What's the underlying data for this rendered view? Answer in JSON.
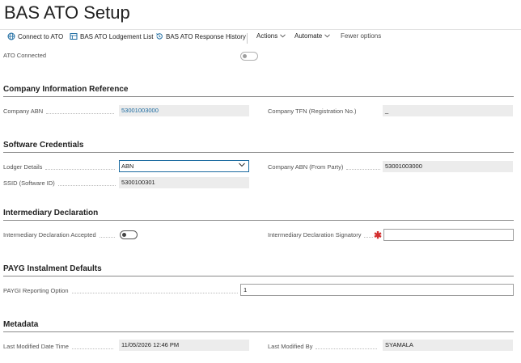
{
  "page": {
    "title": "BAS ATO Setup"
  },
  "toolbar": {
    "connect": "Connect to ATO",
    "lodgement_list": "BAS ATO Lodgement List",
    "response_history": "BAS ATO Response History",
    "actions": "Actions",
    "automate": "Automate",
    "fewer_options": "Fewer options"
  },
  "general": {
    "ato_connected_label": "ATO Connected",
    "ato_connected": false
  },
  "company_info": {
    "heading": "Company Information Reference",
    "abn_label": "Company ABN",
    "abn_value": "53001003000",
    "tfn_label": "Company TFN (Registration No.)",
    "tfn_value": "_"
  },
  "software": {
    "heading": "Software Credentials",
    "lodger_label": "Lodger Details",
    "lodger_value": "ABN",
    "ssid_label": "SSID (Software ID)",
    "ssid_value": "5300100301",
    "abn_party_label": "Company ABN (From Party)",
    "abn_party_value": "53001003000"
  },
  "intermediary": {
    "heading": "Intermediary Declaration",
    "accepted_label": "Intermediary Declaration Accepted",
    "accepted": false,
    "signatory_label": "Intermediary Declaration Signatory",
    "signatory_value": ""
  },
  "payg": {
    "heading": "PAYG Instalment Defaults",
    "option_label": "PAYGI Reporting Option",
    "option_value": "1"
  },
  "metadata": {
    "heading": "Metadata",
    "modified_dt_label": "Last Modified Date Time",
    "modified_dt_value": "11/05/2026 12:46 PM",
    "modified_by_label": "Last Modified By",
    "modified_by_value": "SYAMALA"
  },
  "colors": {
    "accent": "#1a6aa0",
    "required": "#d32f2f"
  }
}
